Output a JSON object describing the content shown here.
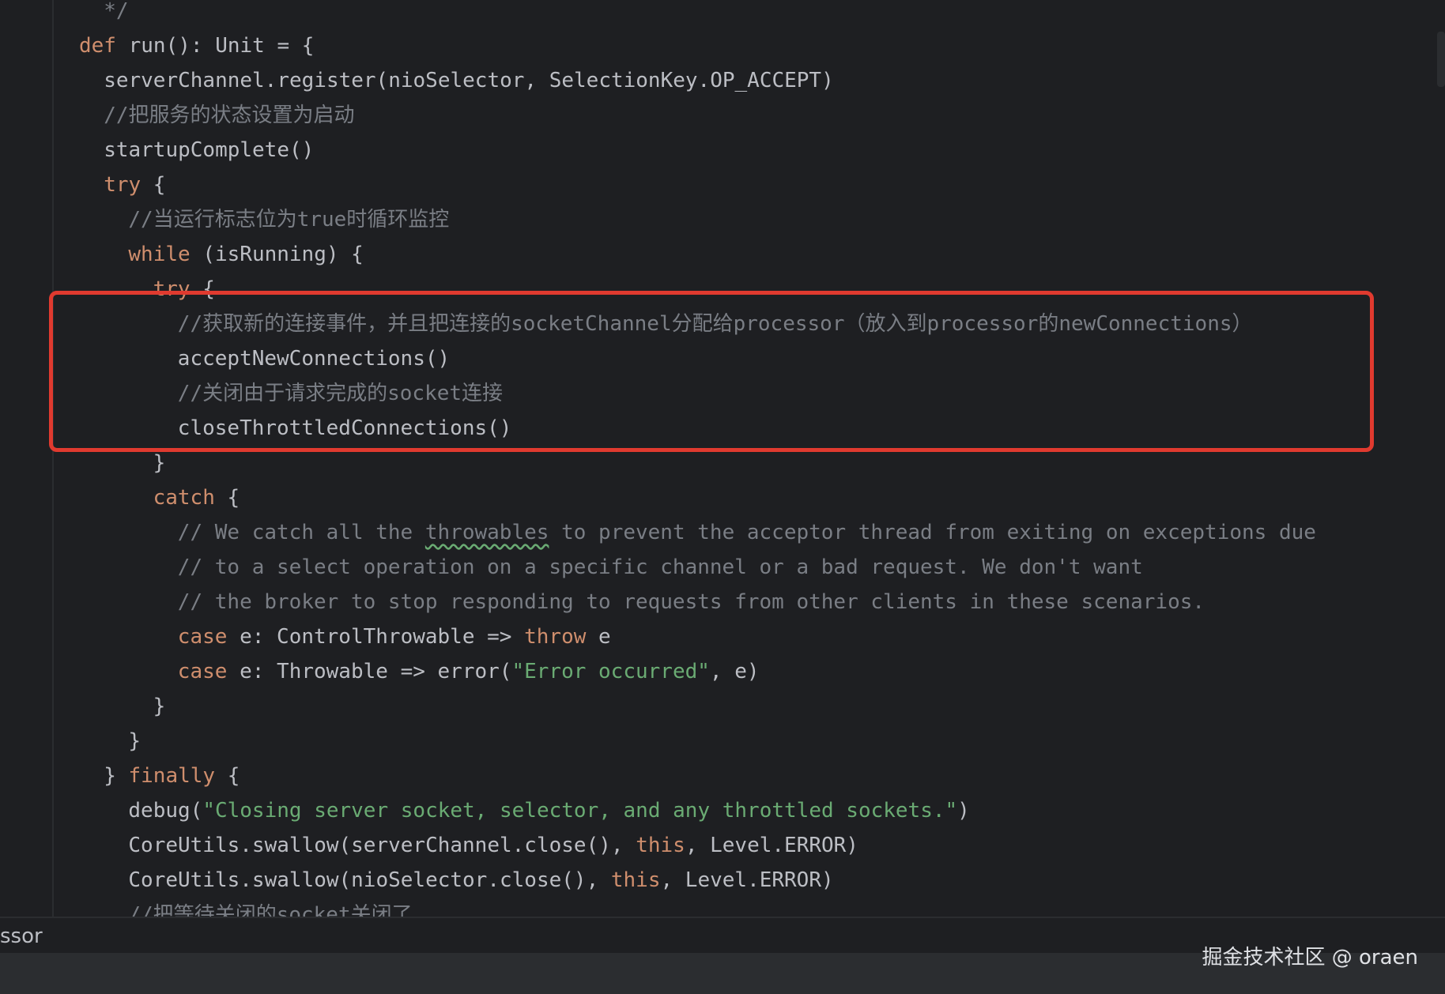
{
  "editor": {
    "lines": [
      {
        "indent": "  ",
        "tokens": [
          {
            "t": "*/",
            "c": "cm"
          }
        ]
      },
      {
        "indent": "",
        "tokens": [
          {
            "t": "def ",
            "c": "kw"
          },
          {
            "t": "run(): Unit = {",
            "c": "plain"
          }
        ]
      },
      {
        "indent": "  ",
        "tokens": [
          {
            "t": "serverChannel.register(nioSelector, SelectionKey.OP_ACCEPT)",
            "c": "plain"
          }
        ]
      },
      {
        "indent": "  ",
        "tokens": [
          {
            "t": "//把服务的状态设置为启动",
            "c": "cm"
          }
        ]
      },
      {
        "indent": "  ",
        "tokens": [
          {
            "t": "startupComplete()",
            "c": "plain"
          }
        ]
      },
      {
        "indent": "  ",
        "tokens": [
          {
            "t": "try",
            "c": "kw"
          },
          {
            "t": " {",
            "c": "plain"
          }
        ]
      },
      {
        "indent": "    ",
        "tokens": [
          {
            "t": "//当运行标志位为true时循环监控",
            "c": "cm"
          }
        ]
      },
      {
        "indent": "    ",
        "tokens": [
          {
            "t": "while",
            "c": "kw"
          },
          {
            "t": " (isRunning) {",
            "c": "plain"
          }
        ]
      },
      {
        "indent": "      ",
        "tokens": [
          {
            "t": "try",
            "c": "kw"
          },
          {
            "t": " {",
            "c": "plain"
          }
        ]
      },
      {
        "indent": "        ",
        "tokens": [
          {
            "t": "//获取新的连接事件，并且把连接的socketChannel分配给processor（放入到processor的newConnections）",
            "c": "cm"
          }
        ]
      },
      {
        "indent": "        ",
        "tokens": [
          {
            "t": "acceptNewConnections()",
            "c": "plain"
          }
        ]
      },
      {
        "indent": "        ",
        "tokens": [
          {
            "t": "//关闭由于请求完成的socket连接",
            "c": "cm"
          }
        ]
      },
      {
        "indent": "        ",
        "tokens": [
          {
            "t": "closeThrottledConnections()",
            "c": "plain"
          }
        ]
      },
      {
        "indent": "      ",
        "tokens": [
          {
            "t": "}",
            "c": "plain"
          }
        ]
      },
      {
        "indent": "      ",
        "tokens": [
          {
            "t": "catch",
            "c": "kw"
          },
          {
            "t": " {",
            "c": "plain"
          }
        ]
      },
      {
        "indent": "        ",
        "tokens": [
          {
            "t": "// We catch all the ",
            "c": "cm"
          },
          {
            "t": "throwables",
            "c": "cm",
            "sq": true
          },
          {
            "t": " to prevent the acceptor thread from exiting on exceptions due",
            "c": "cm"
          }
        ]
      },
      {
        "indent": "        ",
        "tokens": [
          {
            "t": "// to a select operation on a specific channel or a bad request. We don't want",
            "c": "cm"
          }
        ]
      },
      {
        "indent": "        ",
        "tokens": [
          {
            "t": "// the broker to stop responding to requests from other clients in these scenarios.",
            "c": "cm"
          }
        ]
      },
      {
        "indent": "        ",
        "tokens": [
          {
            "t": "case",
            "c": "kw"
          },
          {
            "t": " e: ControlThrowable => ",
            "c": "plain"
          },
          {
            "t": "throw",
            "c": "kw"
          },
          {
            "t": " e",
            "c": "plain"
          }
        ]
      },
      {
        "indent": "        ",
        "tokens": [
          {
            "t": "case",
            "c": "kw"
          },
          {
            "t": " e: Throwable => error(",
            "c": "plain"
          },
          {
            "t": "\"Error occurred\"",
            "c": "str"
          },
          {
            "t": ", e)",
            "c": "plain"
          }
        ]
      },
      {
        "indent": "      ",
        "tokens": [
          {
            "t": "}",
            "c": "plain"
          }
        ]
      },
      {
        "indent": "    ",
        "tokens": [
          {
            "t": "}",
            "c": "plain"
          }
        ]
      },
      {
        "indent": "  ",
        "tokens": [
          {
            "t": "} ",
            "c": "plain"
          },
          {
            "t": "finally",
            "c": "kw"
          },
          {
            "t": " {",
            "c": "plain"
          }
        ]
      },
      {
        "indent": "    ",
        "tokens": [
          {
            "t": "debug(",
            "c": "plain"
          },
          {
            "t": "\"Closing server socket, selector, and any throttled sockets.\"",
            "c": "str"
          },
          {
            "t": ")",
            "c": "plain"
          }
        ]
      },
      {
        "indent": "    ",
        "tokens": [
          {
            "t": "CoreUtils.swallow(serverChannel.close(), ",
            "c": "plain"
          },
          {
            "t": "this",
            "c": "kw"
          },
          {
            "t": ", Level.ERROR)",
            "c": "plain"
          }
        ]
      },
      {
        "indent": "    ",
        "tokens": [
          {
            "t": "CoreUtils.swallow(nioSelector.close(), ",
            "c": "plain"
          },
          {
            "t": "this",
            "c": "kw"
          },
          {
            "t": ", Level.ERROR)",
            "c": "plain"
          }
        ]
      },
      {
        "indent": "    ",
        "tokens": [
          {
            "t": "//把等待关闭的socket关闭了",
            "c": "cm"
          }
        ]
      }
    ]
  },
  "status": {
    "text": "ssor"
  },
  "watermark": {
    "text": "掘金技术社区 @ oraen"
  },
  "colors": {
    "background": "#1e1f22",
    "keyword": "#cf8e6d",
    "comment": "#7a7e85",
    "string": "#6aab73",
    "plain": "#bcbec4",
    "highlight_box": "#e03a2f"
  }
}
